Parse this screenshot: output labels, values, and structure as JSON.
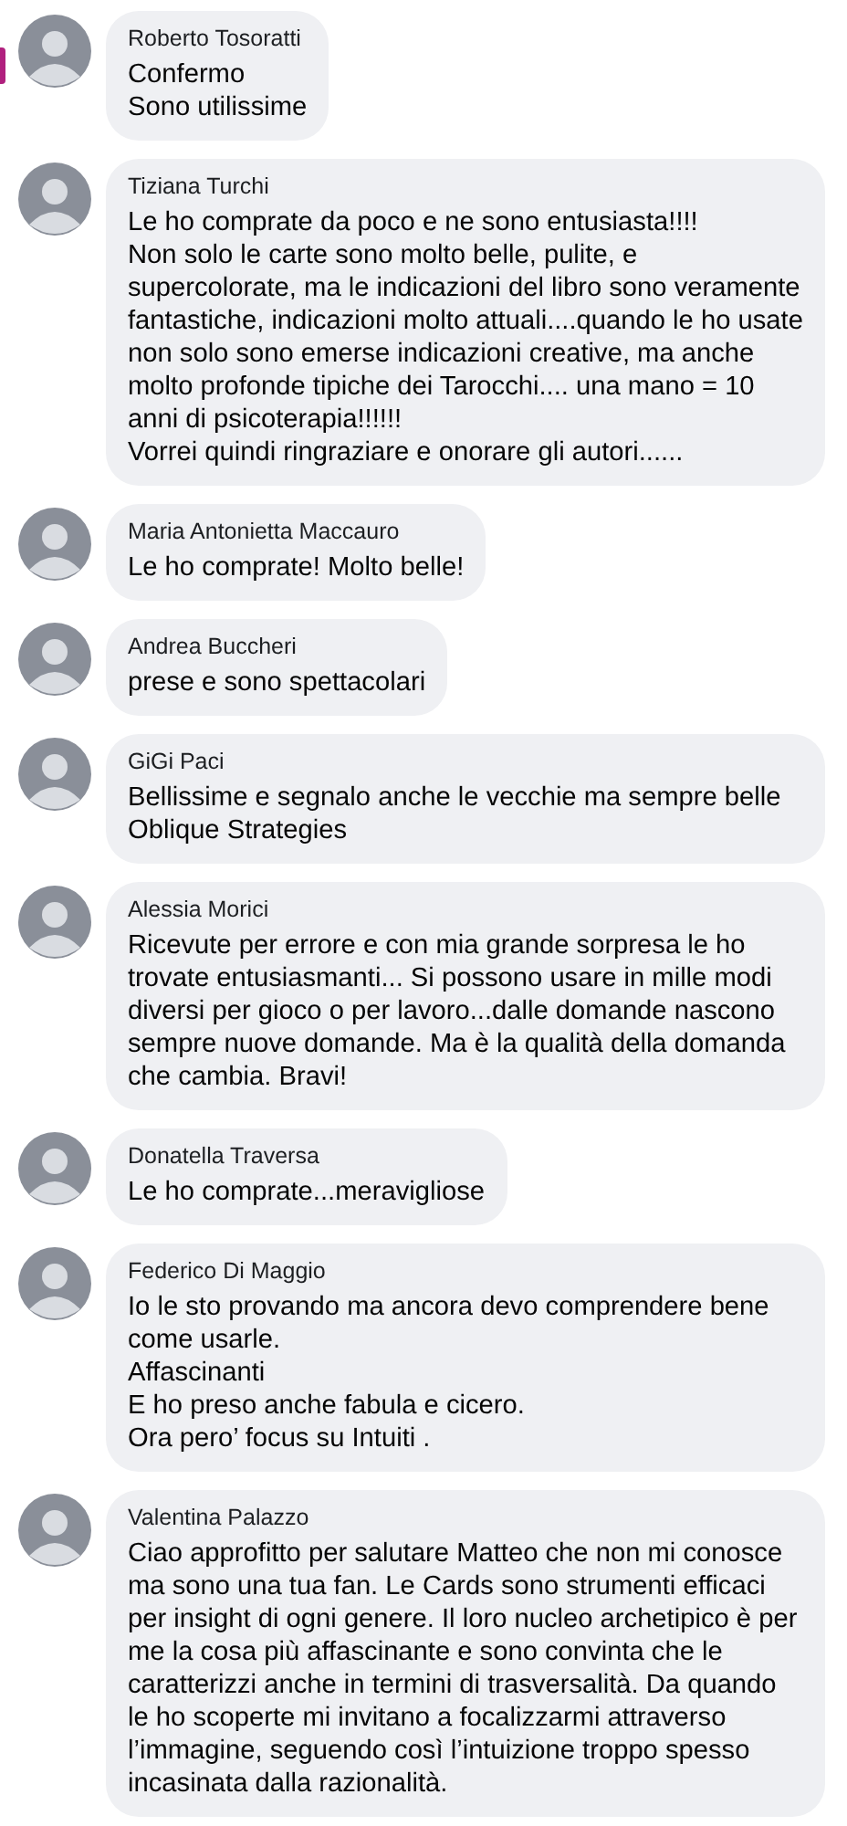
{
  "comments": [
    {
      "author": "Roberto Tosoratti",
      "text": "Confermo\nSono utilissime"
    },
    {
      "author": "Tiziana Turchi",
      "text": "Le ho comprate da poco e ne sono entusiasta!!!!\nNon solo le carte sono molto belle, pulite, e supercolorate, ma le indicazioni del libro sono veramente fantastiche, indicazioni molto attuali....quando le ho usate non solo sono emerse indicazioni creative, ma anche molto profonde tipiche dei Tarocchi.... una mano = 10 anni di psicoterapia!!!!!!\nVorrei quindi ringraziare e onorare gli autori......"
    },
    {
      "author": "Maria Antonietta Maccauro",
      "text": "Le ho comprate! Molto belle!"
    },
    {
      "author": "Andrea Buccheri",
      "text": "prese e sono spettacolari"
    },
    {
      "author": "GiGi Paci",
      "text": "Bellissime e segnalo anche le vecchie ma sempre belle Oblique Strategies"
    },
    {
      "author": "Alessia Morici",
      "text": "Ricevute per errore e con mia grande sorpresa le ho trovate entusiasmanti... Si possono usare in mille modi diversi per gioco o per lavoro...dalle domande nascono sempre nuove domande. Ma è la qualità della domanda che cambia. Bravi!"
    },
    {
      "author": "Donatella Traversa",
      "text": "Le ho comprate...meravigliose"
    },
    {
      "author": "Federico Di Maggio",
      "text": "Io le sto provando ma ancora devo comprendere bene come usarle.\nAffascinanti\nE ho preso anche fabula e cicero.\nOra pero’ focus su Intuiti ."
    },
    {
      "author": "Valentina Palazzo",
      "text": "Ciao approfitto per salutare Matteo che non mi conosce ma sono una tua fan. Le Cards sono strumenti efficaci per insight di ogni genere. Il loro nucleo archetipico è per me la cosa più affascinante e sono convinta che le caratterizzi anche in termini di trasversalità. Da quando le ho scoperte mi invitano a focalizzarmi attraverso l’immagine, seguendo così l’intuizione troppo spesso incasinata dalla razionalità."
    }
  ]
}
